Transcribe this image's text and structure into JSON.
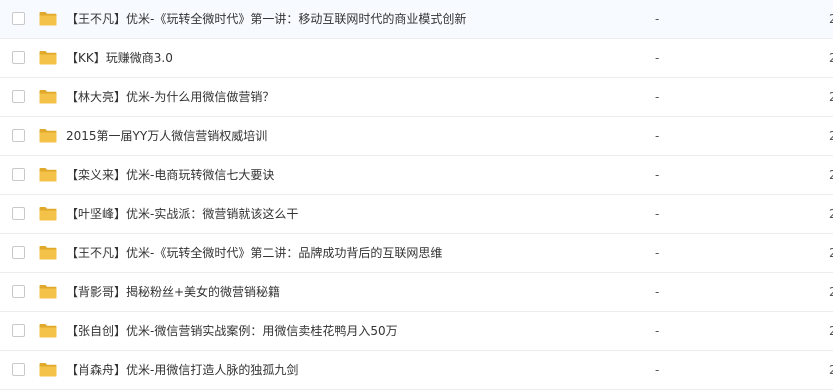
{
  "files": [
    {
      "name": "【王不凡】优米-《玩转全微时代》第一讲：移动互联网时代的商业模式创新",
      "size": "-",
      "date": "2",
      "icon": "folder-icon"
    },
    {
      "name": "【KK】玩赚微商3.0",
      "size": "-",
      "date": "2",
      "icon": "folder-icon"
    },
    {
      "name": "【林大亮】优米-为什么用微信做营销？",
      "size": "-",
      "date": "2",
      "icon": "folder-icon"
    },
    {
      "name": "2015第一届YY万人微信营销权威培训",
      "size": "-",
      "date": "2",
      "icon": "folder-icon"
    },
    {
      "name": "【栾义来】优米-电商玩转微信七大要诀",
      "size": "-",
      "date": "2",
      "icon": "folder-icon"
    },
    {
      "name": "【叶坚峰】优米-实战派：微营销就该这么干",
      "size": "-",
      "date": "2",
      "icon": "folder-icon"
    },
    {
      "name": "【王不凡】优米-《玩转全微时代》第二讲：品牌成功背后的互联网思维",
      "size": "-",
      "date": "2",
      "icon": "folder-icon"
    },
    {
      "name": "【背影哥】揭秘粉丝+美女的微营销秘籍",
      "size": "-",
      "date": "2",
      "icon": "folder-icon"
    },
    {
      "name": "【张自创】优米-微信营销实战案例：用微信卖桂花鸭月入50万",
      "size": "-",
      "date": "2",
      "icon": "folder-icon"
    },
    {
      "name": "【肖森舟】优米-用微信打造人脉的独孤九剑",
      "size": "-",
      "date": "2",
      "icon": "folder-icon"
    }
  ],
  "colors": {
    "folder": "#f4c248",
    "folder_dark": "#e0a92b",
    "checkbox_border": "#c9c9c9",
    "row_divider": "#ececec"
  }
}
